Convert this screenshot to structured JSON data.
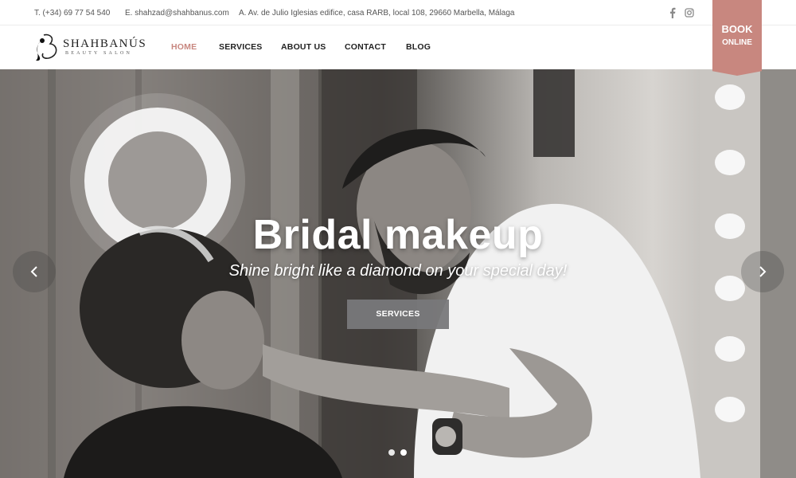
{
  "topbar": {
    "phone": "T. (+34) 69 77 54 540",
    "email": "E. shahzad@shahbanus.com",
    "address": "A. Av. de Julio Iglesias edifice, casa RARB, local 108, 29660 Marbella, Málaga",
    "social": [
      "facebook-icon",
      "instagram-icon"
    ]
  },
  "header": {
    "logo_name": "SHAHBANÚS",
    "logo_sub": "BEAUTY SALON",
    "nav": [
      {
        "label": "HOME",
        "active": true
      },
      {
        "label": "SERVICES"
      },
      {
        "label": "ABOUT US"
      },
      {
        "label": "CONTACT"
      },
      {
        "label": "BLOG"
      }
    ],
    "book": {
      "line1": "BOOK",
      "line2": "ONLINE"
    }
  },
  "hero": {
    "title": "Bridal makeup",
    "subtitle": "Shine bright like a diamond on your special day!",
    "button": "SERVICES",
    "slides": 2,
    "active_slide": 2
  },
  "colors": {
    "accent": "#c8877f",
    "nav_text": "#222222",
    "hero_button": "#78787a"
  }
}
